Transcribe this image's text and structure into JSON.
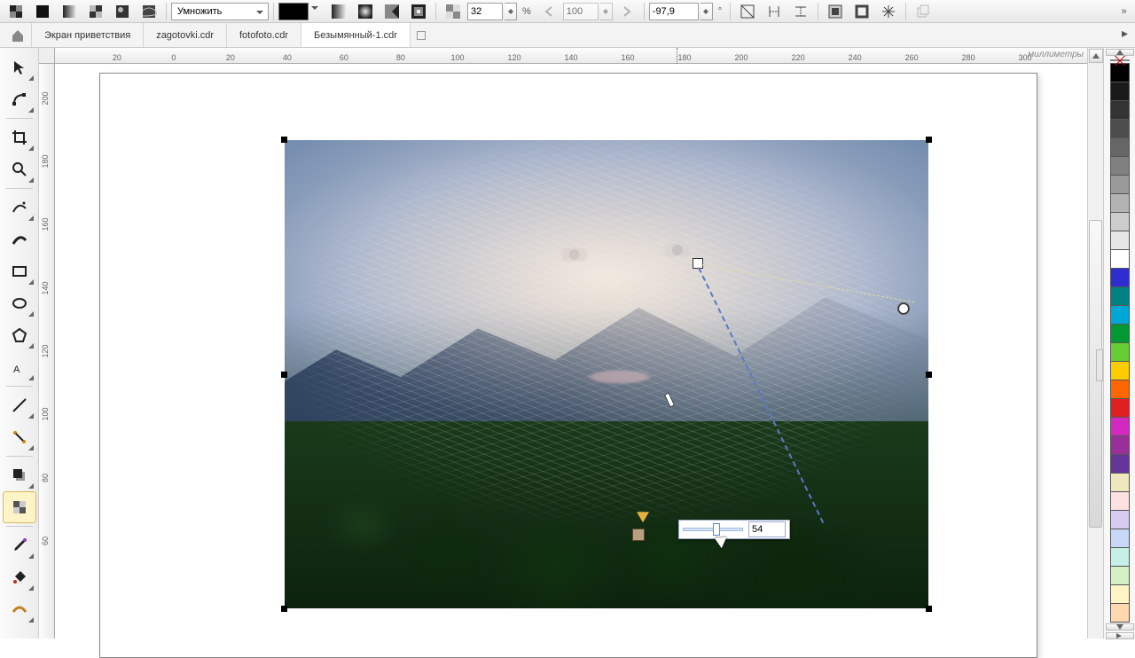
{
  "toolbar": {
    "blend_mode": "Умножить",
    "opacity_value": "32",
    "opacity_unit": "%",
    "size_value": "100",
    "rotation_value": "-97,9",
    "rotation_unit": "°",
    "more": "»"
  },
  "tabs": {
    "home_label": "Экран приветствия",
    "items": [
      "zagotovki.cdr",
      "fotofoto.cdr",
      "Безымянный-1.cdr"
    ],
    "active_index": 2,
    "new_label": "+"
  },
  "rulers": {
    "unit": "миллиметры",
    "h_ticks": [
      {
        "label": "20",
        "pos": 6
      },
      {
        "label": "0",
        "pos": 11.5
      },
      {
        "label": "20",
        "pos": 17
      },
      {
        "label": "40",
        "pos": 22.5
      },
      {
        "label": "60",
        "pos": 28
      },
      {
        "label": "80",
        "pos": 33.5
      },
      {
        "label": "100",
        "pos": 39
      },
      {
        "label": "120",
        "pos": 44.5
      },
      {
        "label": "140",
        "pos": 50
      },
      {
        "label": "160",
        "pos": 55.5
      },
      {
        "label": "180",
        "pos": 61
      },
      {
        "label": "200",
        "pos": 66.5
      },
      {
        "label": "220",
        "pos": 72
      },
      {
        "label": "240",
        "pos": 77.5
      },
      {
        "label": "260",
        "pos": 83
      },
      {
        "label": "280",
        "pos": 88.5
      },
      {
        "label": "300",
        "pos": 94
      }
    ],
    "v_ticks": [
      {
        "label": "200",
        "pos": 6
      },
      {
        "label": "180",
        "pos": 17
      },
      {
        "label": "160",
        "pos": 28
      },
      {
        "label": "140",
        "pos": 39
      },
      {
        "label": "120",
        "pos": 50
      },
      {
        "label": "100",
        "pos": 61
      },
      {
        "label": "80",
        "pos": 72
      },
      {
        "label": "60",
        "pos": 83
      }
    ]
  },
  "slider_popup": {
    "value": "54",
    "thumb_percent": 54
  },
  "palette": [
    "#000000",
    "#1a1a1a",
    "#333333",
    "#4d4d4d",
    "#666666",
    "#808080",
    "#999999",
    "#b3b3b3",
    "#cccccc",
    "#e6e6e6",
    "#ffffff",
    "#2e2ed0",
    "#008080",
    "#00a6d6",
    "#009933",
    "#66cc33",
    "#ffcc00",
    "#ff6600",
    "#e02020",
    "#d429c0",
    "#9a2f9a",
    "#663399",
    "#efe7bd",
    "#fde1e1",
    "#d7ccf0",
    "#c8d8f8",
    "#c6f0e6",
    "#d4f0c6",
    "#fff4c6",
    "#ffd8b0"
  ]
}
